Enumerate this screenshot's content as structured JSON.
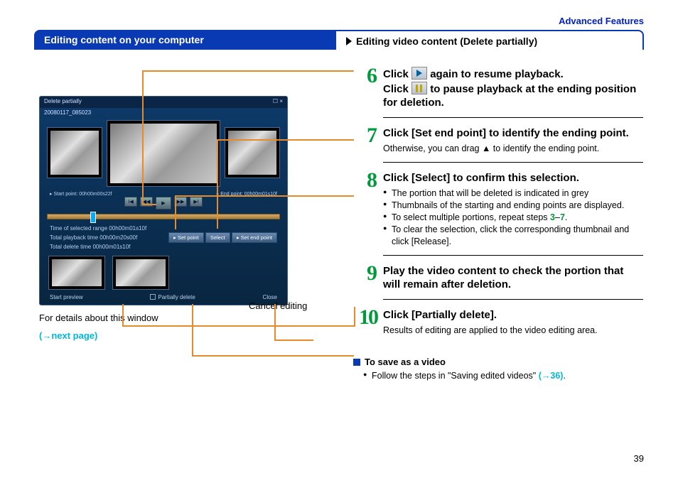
{
  "header": {
    "section": "Advanced Features"
  },
  "titlebar": {
    "left": "Editing content on your computer",
    "right": "Editing video content (Delete partially)"
  },
  "appwindow": {
    "title": "Delete partially",
    "date": "20080117_085023",
    "start_label": "Start point: 00h00m00s22f",
    "end_label": "End point: 00h00m01s10f",
    "time_selected": "Time of selected range  00h00m01s10f",
    "total_playback": "Total playback time   00h00m20s00f",
    "total_delete": "Total delete time   00h00m01s10f",
    "btn_setpoint": "▸ Set point",
    "btn_select": "Select",
    "btn_setendpoint": "▸ Set end point",
    "btn_start_preview": "Start preview",
    "btn_partially_delete": "Partially delete",
    "btn_close": "Close",
    "win_close": "☐ ×"
  },
  "left": {
    "caption": "For details about this window",
    "link": "(→next page)",
    "cancel": "Cancel editing"
  },
  "steps": {
    "s6": {
      "num": "6",
      "t1": "Click ",
      "t2": " again to resume playback.",
      "t3": "Click ",
      "t4": " to pause playback at the ending position for deletion."
    },
    "s7": {
      "num": "7",
      "title": "Click [Set end point] to identify the ending point.",
      "sub": "Otherwise, you can drag ▲ to identify the ending point."
    },
    "s8": {
      "num": "8",
      "title": "Click [Select] to confirm this selection.",
      "b1": "The portion that will be deleted is indicated in grey",
      "b2": "Thumbnails of the starting and ending points are displayed.",
      "b3a": "To select multiple portions, repeat steps ",
      "b3b": "3",
      "b3c": "–",
      "b3d": "7",
      "b3e": ".",
      "b4": "To clear the selection, click the corresponding thumbnail and click [Release]."
    },
    "s9": {
      "num": "9",
      "title": "Play the video content to check the portion that will remain after deletion."
    },
    "s10": {
      "num": "10",
      "title": "Click [Partially delete].",
      "sub": "Results of editing are applied to the video editing area."
    }
  },
  "footer": {
    "heading": "To save as a video",
    "bullet": "Follow the steps in \"Saving edited videos\" ",
    "link": "(→36)",
    "dot": "."
  },
  "page": "39"
}
